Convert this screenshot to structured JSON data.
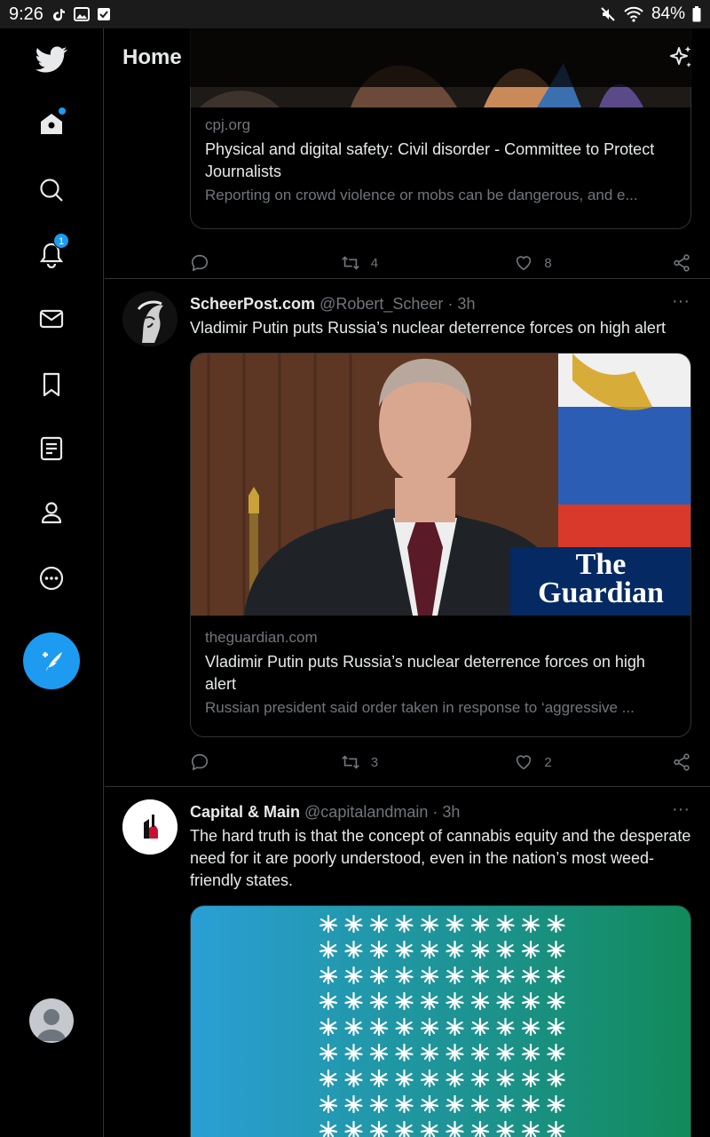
{
  "status_bar": {
    "time": "9:26",
    "battery": "84%"
  },
  "header": {
    "title": "Home"
  },
  "sidebar": {
    "notifications_count": "1",
    "items": [
      {
        "name": "twitter-logo-icon"
      },
      {
        "name": "home-icon"
      },
      {
        "name": "search-icon"
      },
      {
        "name": "notifications-icon"
      },
      {
        "name": "messages-icon"
      },
      {
        "name": "bookmarks-icon"
      },
      {
        "name": "lists-icon"
      },
      {
        "name": "profile-icon"
      },
      {
        "name": "more-icon"
      }
    ]
  },
  "colors": {
    "accent": "#1d9bf0",
    "background": "#000000",
    "border": "#2f3336",
    "muted": "#71767b"
  },
  "tweets": [
    {
      "card": {
        "domain": "cpj.org",
        "title": "Physical and digital safety: Civil disorder - Committee to Protect Journalists",
        "description": "Reporting on crowd violence or mobs can be dangerous, and e..."
      },
      "retweets": "4",
      "likes": "8"
    },
    {
      "name": "ScheerPost.com",
      "handle": "@Robert_Scheer",
      "time": "· 3h",
      "text": "Vladimir Putin puts Russia’s nuclear deterrence forces on high alert",
      "card": {
        "image_logo_line1": "The",
        "image_logo_line2": "Guardian",
        "domain": "theguardian.com",
        "title": "Vladimir Putin puts Russia’s nuclear deterrence forces on high alert",
        "description": "Russian president said order taken in response to ‘aggressive ..."
      },
      "retweets": "3",
      "likes": "2"
    },
    {
      "name": "Capital & Main",
      "handle": "@capitalandmain",
      "time": "· 3h",
      "text": "The hard truth is that the concept of cannabis equity and the desperate need for it are poorly understood, even in the nation’s most weed-friendly states."
    }
  ]
}
